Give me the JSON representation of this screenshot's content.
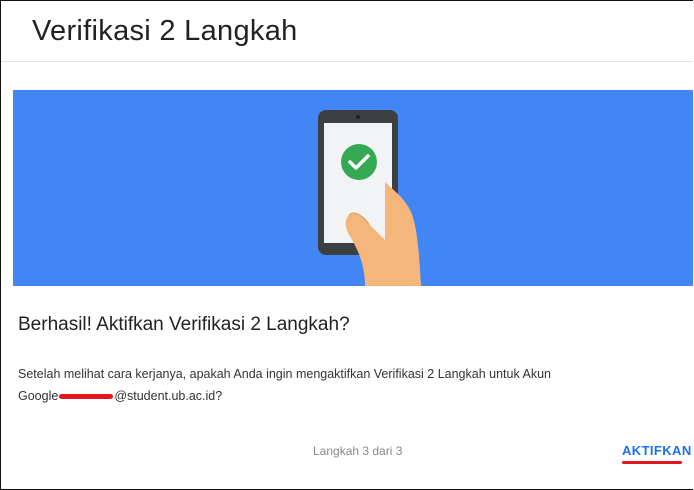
{
  "header": {
    "title": "Verifikasi 2 Langkah"
  },
  "hero": {
    "icon": "phone-check-icon",
    "background": "#4285f4"
  },
  "content": {
    "headline": "Berhasil! Aktifkan Verifikasi 2 Langkah?",
    "body_line1": "Setelah melihat cara kerjanya, apakah Anda ingin mengaktifkan Verifikasi 2 Langkah untuk Akun",
    "body_prefix": "Google",
    "body_suffix": "@student.ub.ac.id?"
  },
  "footer": {
    "step": "Langkah 3 dari 3",
    "action": "AKTIFKAN"
  }
}
